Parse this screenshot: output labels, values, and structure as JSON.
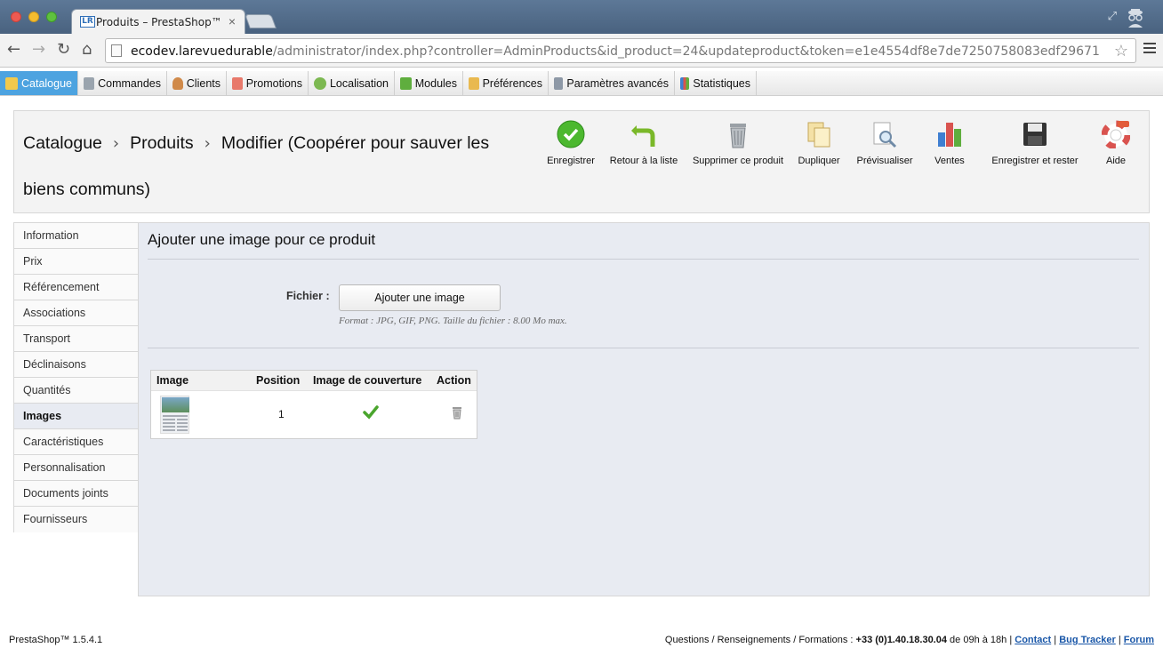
{
  "browser": {
    "tab_title": "Produits – PrestaShop™",
    "tab_favicon": "LR",
    "url_host": "ecodev.larevuedurable",
    "url_path": "/administrator/index.php?controller=AdminProducts&id_product=24&updateproduct&token=e1e4554df8e7de7250758083edf29671"
  },
  "menu": {
    "items": [
      {
        "label": "Catalogue",
        "icon": "folder-icon",
        "active": true
      },
      {
        "label": "Commandes",
        "icon": "cart-icon"
      },
      {
        "label": "Clients",
        "icon": "user-icon"
      },
      {
        "label": "Promotions",
        "icon": "promo-icon"
      },
      {
        "label": "Localisation",
        "icon": "globe-icon"
      },
      {
        "label": "Modules",
        "icon": "puzzle-icon"
      },
      {
        "label": "Préférences",
        "icon": "preferences-icon"
      },
      {
        "label": "Paramètres avancés",
        "icon": "wrench-icon"
      },
      {
        "label": "Statistiques",
        "icon": "stats-icon"
      }
    ]
  },
  "header": {
    "crumb_1": "Catalogue",
    "crumb_2": "Produits",
    "crumb_3_line1": "Modifier (Coopérer pour sauver les",
    "crumb_3_line2": "biens communs)",
    "toolbar": {
      "save": "Enregistrer",
      "back": "Retour à la liste",
      "delete": "Supprimer ce produit",
      "duplicate": "Dupliquer",
      "preview": "Prévisualiser",
      "sales": "Ventes",
      "save_stay": "Enregistrer et rester",
      "help": "Aide"
    }
  },
  "sidetabs": [
    "Information",
    "Prix",
    "Référencement",
    "Associations",
    "Transport",
    "Déclinaisons",
    "Quantités",
    "Images",
    "Caractéristiques",
    "Personnalisation",
    "Documents joints",
    "Fournisseurs"
  ],
  "active_tab": "Images",
  "main": {
    "title": "Ajouter une image pour ce produit",
    "file_label": "Fichier :",
    "add_button": "Ajouter une image",
    "format_hint": "Format : JPG, GIF, PNG. Taille du fichier : 8.00 Mo max.",
    "table": {
      "headers": [
        "Image",
        "Position",
        "Image de couverture",
        "Action"
      ],
      "rows": [
        {
          "position": "1",
          "cover": true
        }
      ]
    }
  },
  "footer": {
    "version": "PrestaShop™ 1.5.4.1",
    "contact_text": "Questions / Renseignements / Formations : ",
    "phone": "+33 (0)1.40.18.30.04",
    "hours": " de 09h à 18h | ",
    "link_contact": "Contact",
    "link_bugtracker": "Bug Tracker",
    "link_forum": "Forum"
  },
  "colors": {
    "menu_active": "#4da3e0",
    "panel_bg": "#e8ebf2",
    "link": "#1a57a8"
  }
}
